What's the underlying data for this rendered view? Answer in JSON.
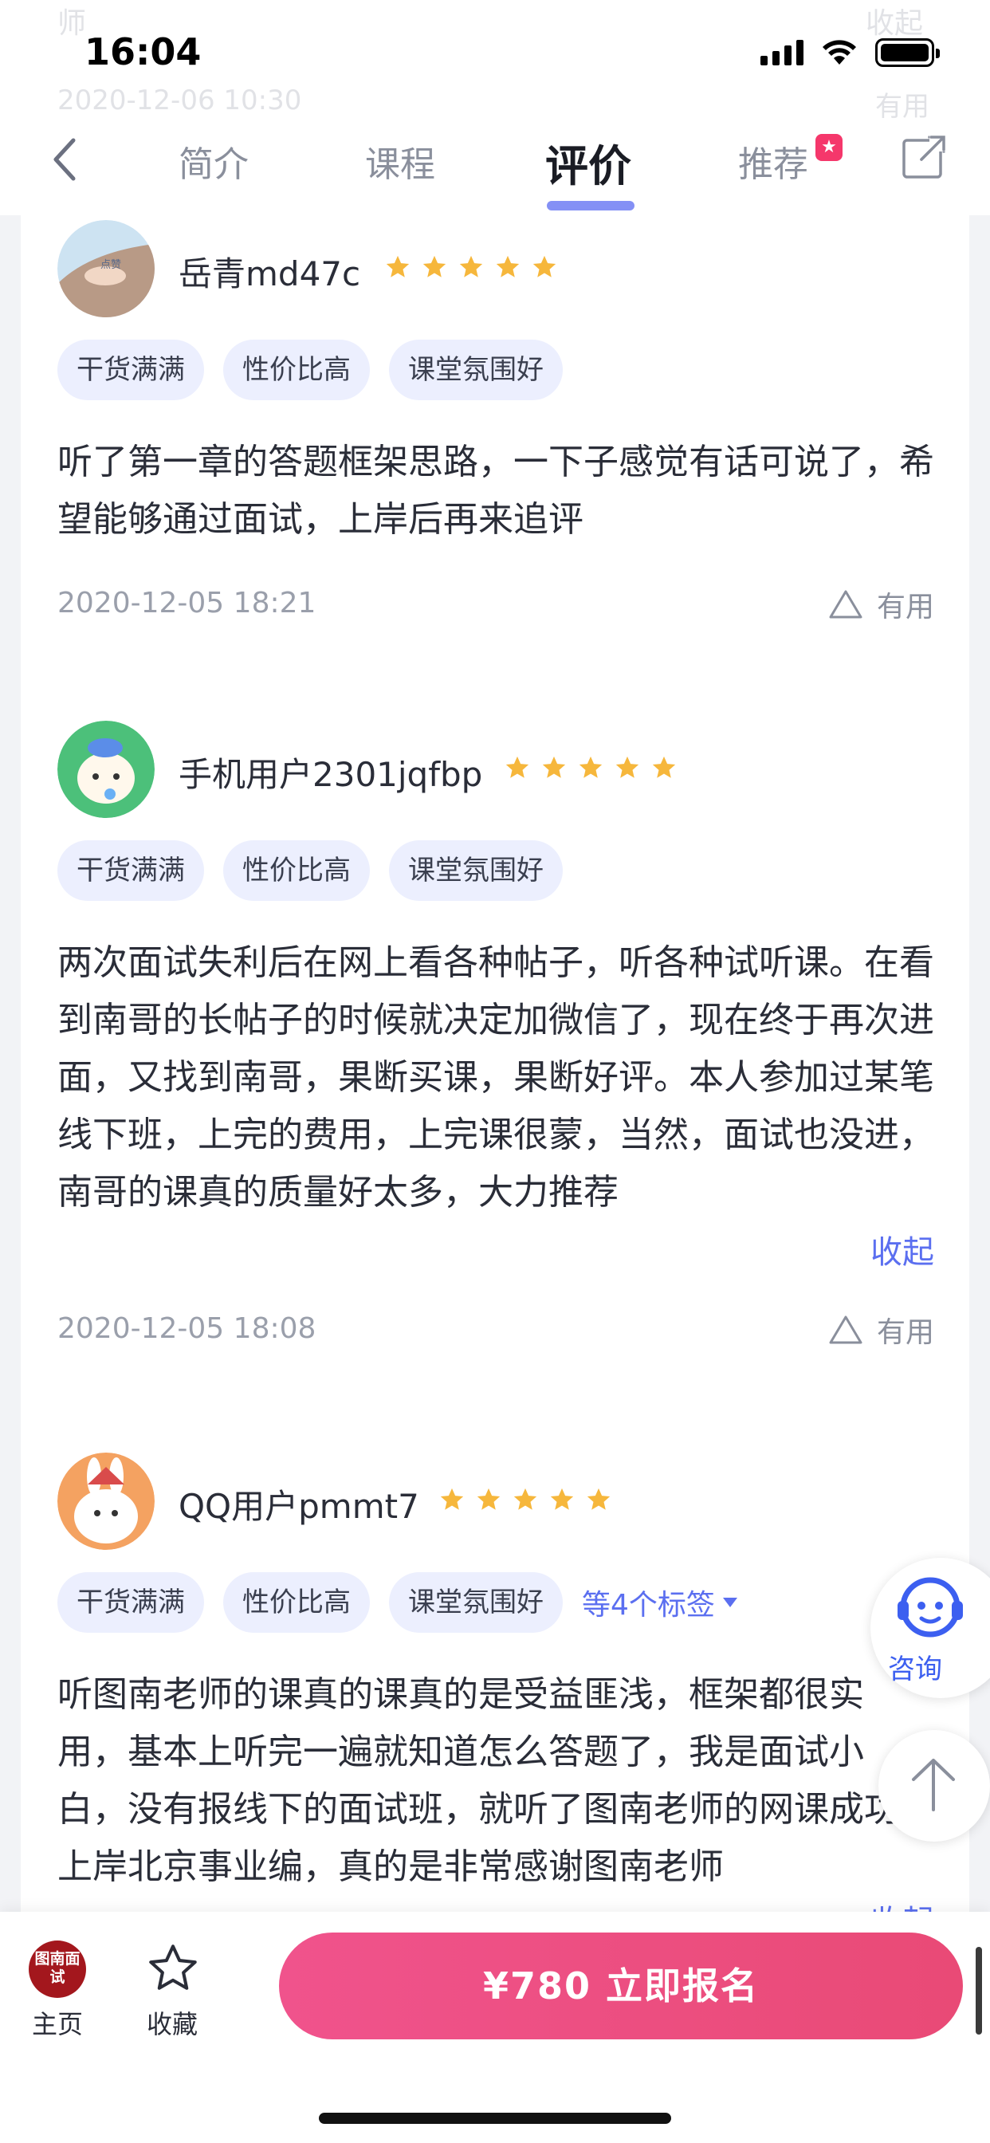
{
  "status_bar": {
    "time": "16:04"
  },
  "ghost": {
    "top_left": "师",
    "top_right": "收起",
    "date": "2020-12-06 10:30",
    "useful": "有用"
  },
  "nav": {
    "tabs": [
      {
        "label": "简介"
      },
      {
        "label": "课程"
      },
      {
        "label": "评价",
        "active": true
      },
      {
        "label": "推荐"
      }
    ],
    "accent_color": "#6f7df3"
  },
  "reviews": [
    {
      "username": "岳青md47c",
      "rating": 5,
      "tags": [
        "干货满满",
        "性价比高",
        "课堂氛围好"
      ],
      "content": "听了第一章的答题框架思路，一下子感觉有话可说了，希望能够通过面试，上岸后再来追评",
      "date": "2020-12-05 18:21",
      "useful_label": "有用"
    },
    {
      "username": "手机用户2301jqfbp",
      "rating": 5,
      "tags": [
        "干货满满",
        "性价比高",
        "课堂氛围好"
      ],
      "content": "两次面试失利后在网上看各种帖子，听各种试听课。在看到南哥的长帖子的时候就决定加微信了，现在终于再次进面，又找到南哥，果断买课，果断好评。本人参加过某笔线下班，上完的费用，上完课很蒙，当然，面试也没进，南哥的课真的质量好太多，大力推荐",
      "collapse_label": "收起",
      "date": "2020-12-05 18:08",
      "useful_label": "有用"
    },
    {
      "username": "QQ用户pmmt7",
      "rating": 5,
      "tags": [
        "干货满满",
        "性价比高",
        "课堂氛围好"
      ],
      "more_tags": "等4个标签",
      "content": "听图南老师的课真的课真的是受益匪浅，框架都很实用，基本上听完一遍就知道怎么答题了，我是面试小白，没有报线下的面试班，就听了图南老师的网课成功上岸北京事业编，真的是非常感谢图南老师",
      "collapse_label": "收起"
    }
  ],
  "floating": {
    "consult_label": "咨询"
  },
  "bottom_bar": {
    "home_logo": "图南面试",
    "home_label": "主页",
    "fav_label": "收藏",
    "enroll_label": "¥780  立即报名",
    "enroll_color": "#ec4f82"
  }
}
